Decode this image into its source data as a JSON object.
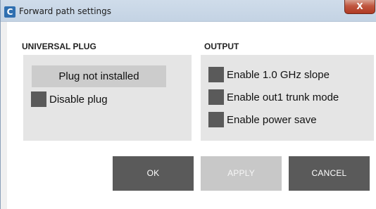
{
  "window": {
    "title": "Forward path settings",
    "app_icon_glyph": "C",
    "close_glyph": "X"
  },
  "universal_plug": {
    "heading": "UNIVERSAL PLUG",
    "status": "Plug not installed",
    "disable_label": "Disable plug",
    "disable_checked": false
  },
  "output": {
    "heading": "OUTPUT",
    "options": [
      {
        "label": "Enable 1.0 GHz slope",
        "checked": false
      },
      {
        "label": "Enable out1 trunk mode",
        "checked": false
      },
      {
        "label": "Enable power save",
        "checked": false
      }
    ]
  },
  "buttons": {
    "ok": "OK",
    "apply": "APPLY",
    "cancel": "CANCEL"
  },
  "colors": {
    "panel": "#e5e5e5",
    "status_box": "#cccccc",
    "checkbox": "#5a5a5a",
    "button_active": "#5a5a5a",
    "button_disabled": "#c8c8c8",
    "title_bar": "#c8d6e6",
    "close_button": "#c0563f"
  }
}
